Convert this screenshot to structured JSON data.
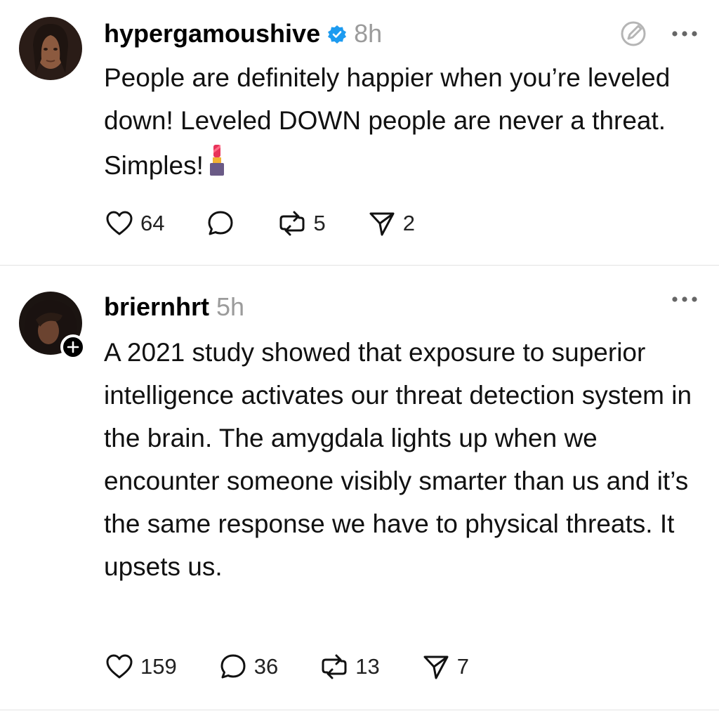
{
  "posts": [
    {
      "username": "hypergamoushive",
      "verified": true,
      "time": "8h",
      "text": "People are definitely happier when you’re leveled down! Leveled DOWN people are never a threat. Simples!",
      "emoji": "lipstick",
      "likes": "64",
      "replies": "",
      "reposts": "5",
      "shares": "2"
    },
    {
      "username": "briernhrt",
      "verified": false,
      "time": "5h",
      "text": "A 2021 study showed that exposure to superior intelligence activates our threat detection system in the brain. The amygdala lights up when we encounter someone visibly smarter than us and it’s the same response we have to physical threats. It upsets us.",
      "likes": "159",
      "replies": "36",
      "reposts": "13",
      "shares": "7"
    }
  ],
  "colors": {
    "verified": "#1d9bf0",
    "muted": "#9b9b9b",
    "divider": "#e3e3e3"
  }
}
